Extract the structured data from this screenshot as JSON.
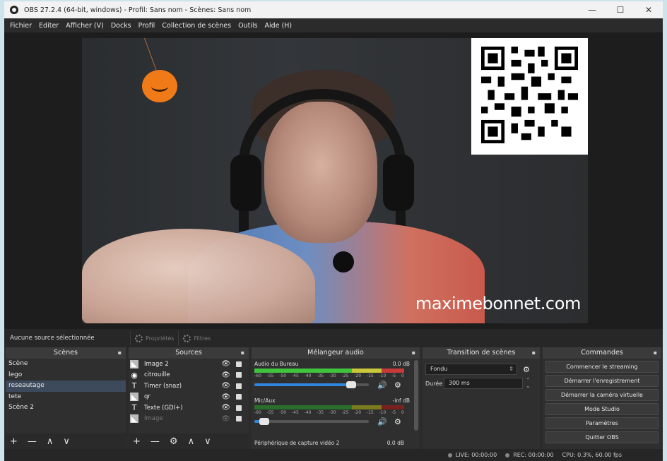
{
  "window": {
    "title": "OBS 27.2.4 (64-bit, windows) - Profil: Sans nom - Scènes: Sans nom",
    "controls": {
      "minimize": "—",
      "maximize": "☐",
      "close": "✕"
    }
  },
  "menu": [
    "Fichier",
    "Editer",
    "Afficher (V)",
    "Docks",
    "Profil",
    "Collection de scènes",
    "Outils",
    "Aide (H)"
  ],
  "preview": {
    "watermark": "maximebonnet.com"
  },
  "context_bar": {
    "no_source": "Aucune source sélectionnée",
    "properties": "Propriétés",
    "filters": "Filtres"
  },
  "scenes": {
    "title": "Scènes",
    "items": [
      "Scène",
      "lego",
      "reseautage",
      "tete",
      "Scène 2"
    ],
    "selected_index": 2
  },
  "sources": {
    "title": "Sources",
    "items": [
      {
        "name": "Image 2",
        "icon": "image-icon"
      },
      {
        "name": "citrouille",
        "icon": "media-icon"
      },
      {
        "name": "Timer (snaz)",
        "icon": "text-icon"
      },
      {
        "name": "qr",
        "icon": "image-icon"
      },
      {
        "name": "Texte (GDI+)",
        "icon": "text-icon"
      },
      {
        "name": "Image",
        "icon": "image-icon"
      }
    ]
  },
  "mixer": {
    "title": "Mélangeur audio",
    "ticks": [
      "-60",
      "-55",
      "-50",
      "-45",
      "-40",
      "-35",
      "-30",
      "-25",
      "-20",
      "-15",
      "-10",
      "-5",
      "0"
    ],
    "channels": [
      {
        "name": "Audio du Bureau",
        "db": "0.0 dB",
        "volume": 0.88
      },
      {
        "name": "Mic/Aux",
        "db": "-inf dB",
        "volume": 0.05
      }
    ],
    "third_channel": {
      "name": "Périphérique de capture vidéo 2",
      "db": "0.0 dB"
    }
  },
  "transitions": {
    "title": "Transition de scènes",
    "selected": "Fondu",
    "duration_label": "Durée",
    "duration_value": "300 ms"
  },
  "commands": {
    "title": "Commandes",
    "buttons": [
      "Commencer le streaming",
      "Démarrer l'enregistrement",
      "Démarrer la caméra virtuelle",
      "Mode Studio",
      "Paramètres",
      "Quitter OBS"
    ]
  },
  "status": {
    "live": "LIVE: 00:00:00",
    "rec": "REC: 00:00:00",
    "cpu": "CPU: 0.3%, 60.00 fps"
  },
  "footer_symbols": {
    "add": "+",
    "remove": "—",
    "up": "∧",
    "down": "∨",
    "settings": "⚙"
  },
  "colors": {
    "accent": "#2f86e0",
    "selected_row": "#3c4a5c",
    "pumpkin": "#f07a18"
  }
}
